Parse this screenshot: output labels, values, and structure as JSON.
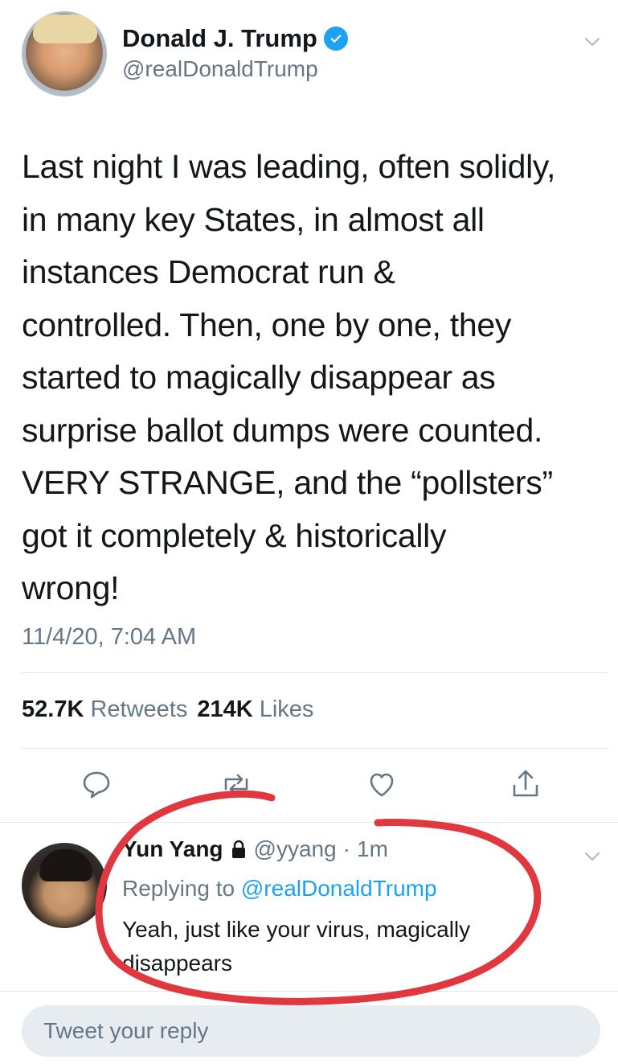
{
  "tweet": {
    "author_name": "Donald J. Trump",
    "author_handle": "@realDonaldTrump",
    "text": "Last night I was leading, often solidly,\nin many key States, in almost all\ninstances Democrat run &\ncontrolled. Then, one by one, they\nstarted to magically disappear as\nsurprise ballot dumps were counted.\nVERY STRANGE, and the “pollsters”\ngot it completely & historically\nwrong!",
    "timestamp": "11/4/20, 7:04 AM",
    "retweets_count": "52.7K",
    "retweets_label": "Retweets",
    "likes_count": "214K",
    "likes_label": "Likes"
  },
  "reply": {
    "author_name": "Yun Yang",
    "author_handle": "@yyang",
    "separator": "·",
    "time": "1m",
    "replying_prefix": "Replying to",
    "replying_to": "@realDonaldTrump",
    "text": "Yeah, just like your virus, magically disappears"
  },
  "composer": {
    "placeholder": "Tweet your reply"
  },
  "icons": {
    "verified": "verified-badge-icon",
    "menu": "chevron-down-icon",
    "reply": "reply-icon",
    "retweet": "retweet-icon",
    "like": "heart-icon",
    "share": "share-icon",
    "lock": "lock-icon"
  },
  "colors": {
    "accent": "#1da1f2",
    "secondary_text": "#657786",
    "annotation_stroke": "#e0383e"
  }
}
